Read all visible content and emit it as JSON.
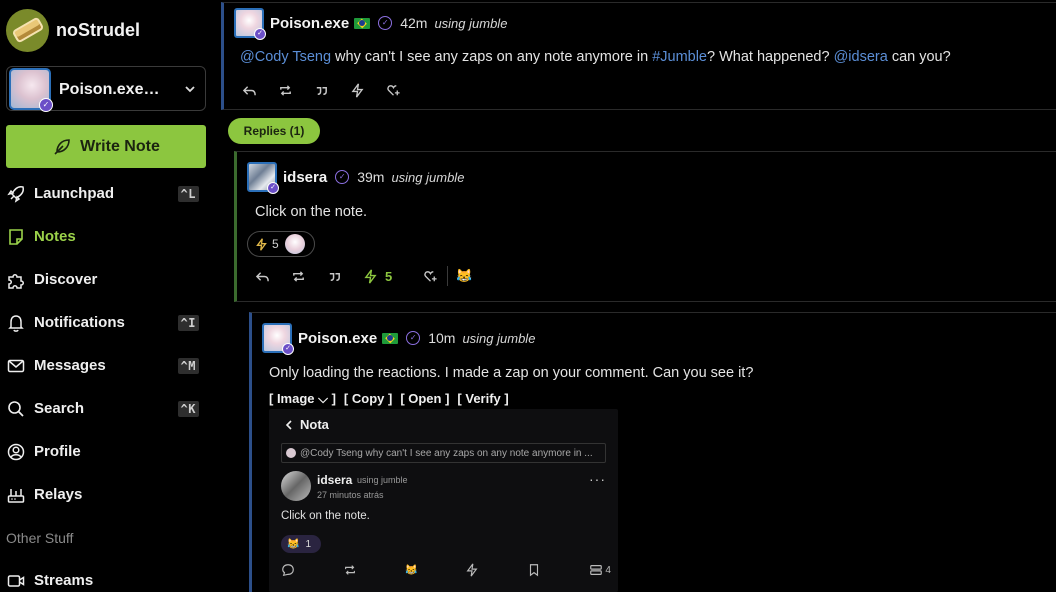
{
  "app": {
    "name": "noStrudel"
  },
  "account": {
    "name": "Poison.exe 🇧🇷"
  },
  "write_button": {
    "label": "Write Note"
  },
  "nav": {
    "items": [
      {
        "label": "Launchpad",
        "shortcut": "^L",
        "icon": "rocket-icon"
      },
      {
        "label": "Notes",
        "shortcut": "",
        "icon": "note-icon",
        "active": true
      },
      {
        "label": "Discover",
        "shortcut": "",
        "icon": "puzzle-icon"
      },
      {
        "label": "Notifications",
        "shortcut": "^I",
        "icon": "bell-icon"
      },
      {
        "label": "Messages",
        "shortcut": "^M",
        "icon": "mail-icon"
      },
      {
        "label": "Search",
        "shortcut": "^K",
        "icon": "search-icon"
      },
      {
        "label": "Profile",
        "shortcut": "",
        "icon": "user-circle-icon"
      },
      {
        "label": "Relays",
        "shortcut": "",
        "icon": "router-icon"
      }
    ],
    "section_label": "Other Stuff",
    "streams_label": "Streams"
  },
  "colors": {
    "accent": "#8cc63f",
    "mention": "#5b8ed6",
    "verified": "#8b6fe0"
  },
  "root_note": {
    "author": "Poison.exe",
    "time": "42m",
    "client": "using jumble",
    "text_mention1": "@Cody Tseng",
    "text_part1": " why can't I see any zaps on any note anymore in ",
    "text_hashtag": "#Jumble",
    "text_part2": "? What happened? ",
    "text_mention2": "@idsera",
    "text_part3": " can you?"
  },
  "replies_badge": "Replies (1)",
  "reply1": {
    "author": "idsera",
    "time": "39m",
    "client": "using jumble",
    "text": "Click on the note.",
    "zap_chip_count": "5",
    "zap_count": "5",
    "emoji": "😹"
  },
  "reply2": {
    "author": "Poison.exe",
    "time": "10m",
    "client": "using jumble",
    "text": "Only loading the reactions. I made a zap on your comment. Can you see it?",
    "links": [
      "[ Image ⌵ ]",
      "[ Copy ]",
      "[ Open ]",
      "[ Verify ]"
    ]
  },
  "embed": {
    "title": "Nota",
    "quote": "@Cody Tseng why can't I see any zaps on any note anymore in ...",
    "author": "idsera",
    "client": "using jumble",
    "time": "27 minutos atrás",
    "text": "Click on the note.",
    "react_count": "1",
    "emoji": "😹",
    "relay_count": "4"
  }
}
